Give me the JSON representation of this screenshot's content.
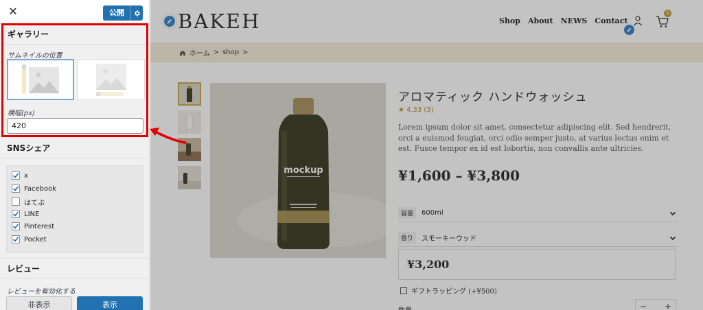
{
  "panel": {
    "close_glyph": "✕",
    "publish_label": "公開",
    "gallery": {
      "title": "ギャラリー",
      "thumb_position_label": "サムネイルの位置",
      "options": [
        "left-thumbnails",
        "bottom-thumbnails"
      ],
      "selected_option": "left-thumbnails",
      "width_label": "横幅(px)",
      "width_value": "420"
    },
    "sns": {
      "title": "SNSシェア",
      "items": [
        {
          "label": "x",
          "checked": true
        },
        {
          "label": "Facebook",
          "checked": true
        },
        {
          "label": "はてぶ",
          "checked": false
        },
        {
          "label": "LINE",
          "checked": true
        },
        {
          "label": "Pinterest",
          "checked": true
        },
        {
          "label": "Pocket",
          "checked": true
        }
      ]
    },
    "review": {
      "title": "レビュー",
      "enable_label": "レビューを有効化する",
      "hide_label": "非表示",
      "show_label": "表示",
      "selected": "show"
    }
  },
  "site": {
    "logo": "BAKEH",
    "nav": [
      "Shop",
      "About",
      "NEWS",
      "Contact"
    ],
    "cart_count": "0",
    "breadcrumb": {
      "home": "ホーム",
      "separator": ">",
      "shop": "shop"
    },
    "product": {
      "bottle_label": "mockup",
      "title": "アロマティック ハンドウォッシュ",
      "rating": "4.33",
      "rating_count": "(3)",
      "description": "Lorem ipsum dolor sit amet, consectetur adipiscing elit. Sed hendrerit, orci a euismod feugiat, orci odio semper justo, at varius lectus enim et est. Fusce tempor ex id est lobortis, non convallis ante ultricies.",
      "price_range": "¥1,600 – ¥3,800",
      "variations": [
        {
          "tag": "容量",
          "value": "600ml"
        },
        {
          "tag": "香り",
          "value": "スモーキーウッド"
        }
      ],
      "selected_price": "¥3,200",
      "gift_label": "ギフトラッピング (+¥500)",
      "quantity_label": "数量",
      "qty_minus": "−",
      "qty_plus": "+"
    }
  },
  "colors": {
    "accent_blue": "#2271b1",
    "highlight_red": "#e00000",
    "gold": "#c69b32",
    "breadcrumb_bg": "#f4ecd9"
  }
}
